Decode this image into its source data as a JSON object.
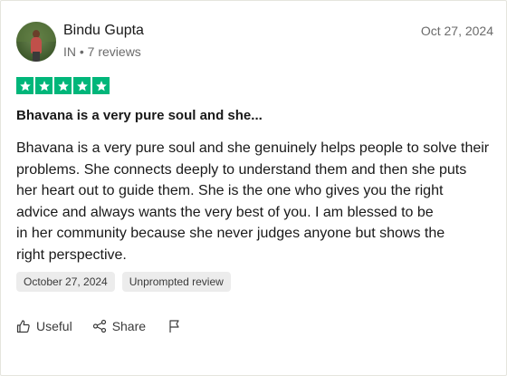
{
  "reviewer": {
    "name": "Bindu Gupta",
    "meta": "IN • 7 reviews"
  },
  "review": {
    "date": "Oct 27, 2024",
    "rating": 5,
    "max_rating": 5,
    "star_color": "#00b67a",
    "title": "Bhavana is a very pure soul and she...",
    "body_lines": [
      "Bhavana is a very pure soul and she genuinely helps people to solve their",
      "problems. She connects deeply to understand them and then she puts",
      "her heart out to guide them. She is the one who gives you the right",
      "advice and always wants the very best of you. I am blessed to be",
      "in her community because she never judges anyone but shows the",
      "right perspective."
    ],
    "tags": [
      "October 27, 2024",
      "Unprompted review"
    ]
  },
  "actions": {
    "useful_label": "Useful",
    "share_label": "Share",
    "icons": [
      "thumbs-up-icon",
      "share-icon",
      "flag-icon"
    ]
  }
}
